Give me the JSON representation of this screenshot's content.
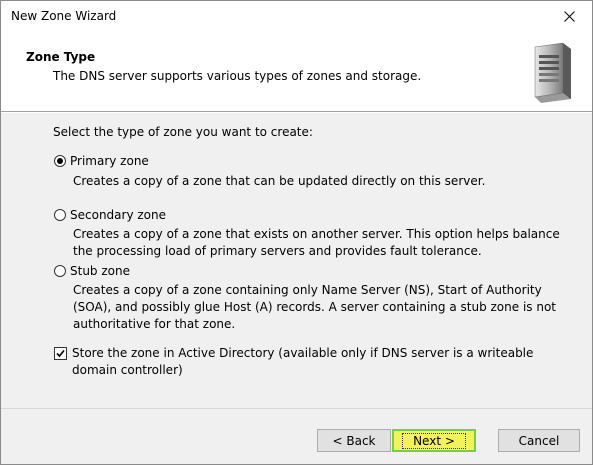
{
  "window": {
    "title": "New Zone Wizard"
  },
  "header": {
    "title": "Zone Type",
    "subtitle": "The DNS server supports various types of zones and storage."
  },
  "prompt": "Select the type of zone you want to create:",
  "options": [
    {
      "label": "Primary zone",
      "selected": true,
      "desc": "Creates a copy of a zone that can be updated directly on this server."
    },
    {
      "label": "Secondary zone",
      "selected": false,
      "desc": "Creates a copy of a zone that exists on another server. This option helps balance the processing load of primary servers and provides fault tolerance."
    },
    {
      "label": "Stub zone",
      "selected": false,
      "desc": "Creates a copy of a zone containing only Name Server (NS), Start of Authority (SOA), and possibly glue Host (A) records. A server containing a stub zone is not authoritative for that zone."
    }
  ],
  "store_ad": {
    "checked": true,
    "label": "Store the zone in Active Directory (available only if DNS server is a writeable domain controller)"
  },
  "buttons": {
    "back": "< Back",
    "next": "Next >",
    "cancel": "Cancel"
  }
}
